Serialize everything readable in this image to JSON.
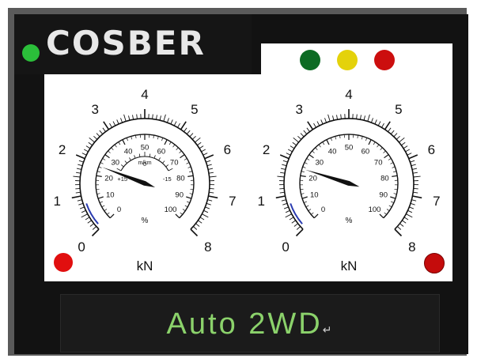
{
  "brand": {
    "logo_text": "COSBER"
  },
  "colors": {
    "status_led": "#2bbf3a",
    "lamp_green": "#0d6b24",
    "lamp_yellow": "#e4d20b",
    "lamp_red": "#cc0e0e",
    "alarm_red": "#e10f0f",
    "display_text": "#8bd26b"
  },
  "icons": {
    "status_led": "status-led-icon",
    "lamp_green": "green-indicator-icon",
    "lamp_yellow": "yellow-indicator-icon",
    "lamp_red": "red-indicator-icon",
    "alarm_left": "red-alarm-icon",
    "alarm_right": "red-alarm-icon"
  },
  "gauges": [
    {
      "outer_scale": [
        "0",
        "1",
        "2",
        "3",
        "4",
        "5",
        "6",
        "7",
        "8"
      ],
      "outer_unit": "kN",
      "inner_scale": [
        "0",
        "10",
        "20",
        "30",
        "40",
        "50",
        "60",
        "70",
        "80",
        "90",
        "100"
      ],
      "inner_unit": "%",
      "sub_scale": [
        "+15",
        "0",
        "-15"
      ],
      "sub_unit": "m/km",
      "needle_value": 1.95
    },
    {
      "outer_scale": [
        "0",
        "1",
        "2",
        "3",
        "4",
        "5",
        "6",
        "7",
        "8"
      ],
      "outer_unit": "kN",
      "inner_scale": [
        "0",
        "10",
        "20",
        "30",
        "40",
        "50",
        "60",
        "70",
        "80",
        "90",
        "100"
      ],
      "inner_unit": "%",
      "needle_value": 1.85
    }
  ],
  "display": {
    "mode": "Auto 2WD",
    "return_mark": "↵"
  }
}
